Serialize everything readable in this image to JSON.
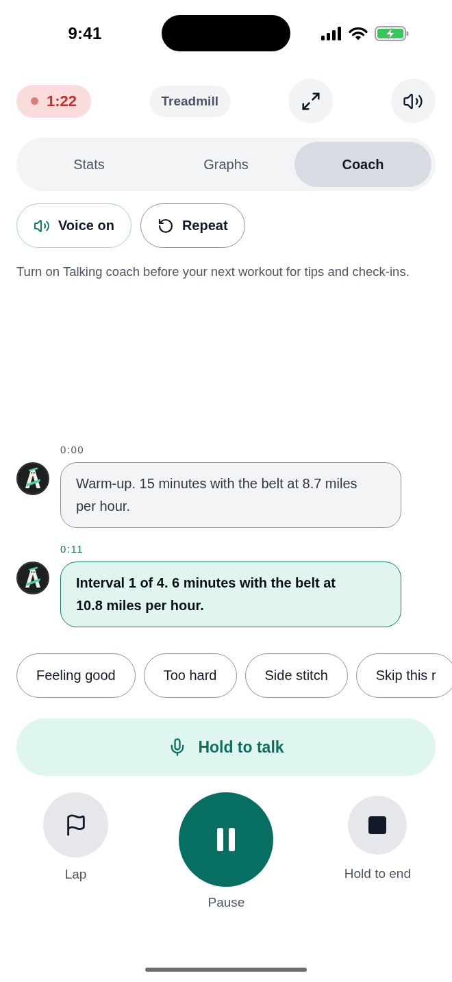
{
  "status_bar": {
    "time": "9:41"
  },
  "header": {
    "timer": {
      "text": "1:22",
      "recording": true
    },
    "equipment": "Treadmill"
  },
  "tabs": [
    {
      "label": "Stats",
      "selected": false
    },
    {
      "label": "Graphs",
      "selected": false
    },
    {
      "label": "Coach",
      "selected": true
    }
  ],
  "voice_toggle": {
    "label": "Voice on",
    "on": true
  },
  "repeat_button": {
    "label": "Repeat"
  },
  "hint": "Turn on Talking coach before your next workout for tips and check-ins.",
  "messages": [
    {
      "time": "0:00",
      "text": "Warm-up. 15 minutes with the belt at 8.7 miles per hour.",
      "current": false
    },
    {
      "time": "0:11",
      "text": "Interval 1 of 4. 6 minutes with the belt at 10.8 miles per hour.",
      "current": true
    }
  ],
  "quick_replies": [
    "Feeling good",
    "Too hard",
    "Side stitch",
    "Skip this r"
  ],
  "talk_button": {
    "label": "Hold to talk"
  },
  "controls": [
    {
      "kind": "lap",
      "label": "Lap"
    },
    {
      "kind": "pause",
      "label": "Pause"
    },
    {
      "kind": "end",
      "label": "Hold to end"
    }
  ]
}
